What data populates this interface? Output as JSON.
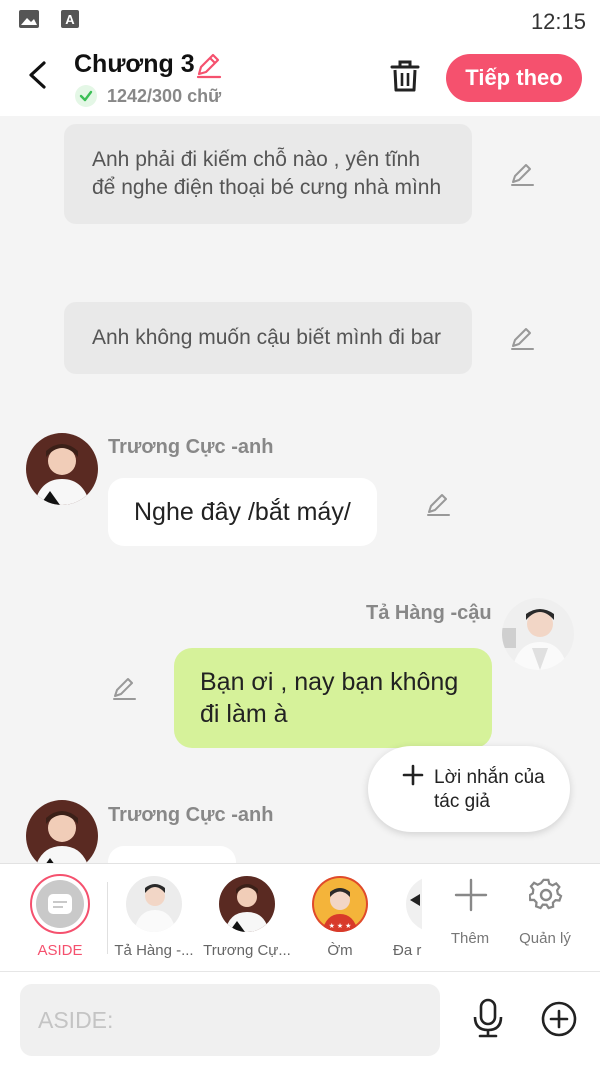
{
  "status_bar": {
    "time": "12:15"
  },
  "header": {
    "title": "Chương 3",
    "word_count": "1242/300 chữ",
    "next_label": "Tiếp theo"
  },
  "messages": {
    "narration_1": "Anh phải đi kiếm chỗ nào , yên tĩnh để nghe điện thoại bé cưng nhà mình",
    "narration_2": "Anh không muốn cậu biết mình đi bar",
    "msg_1": {
      "sender": "Trương Cực -anh",
      "text": "Nghe đây /bắt máy/"
    },
    "msg_2": {
      "sender": "Tả Hàng -cậu",
      "text": "Bạn ơi , nay bạn không đi làm à"
    },
    "msg_3": {
      "sender": "Trương Cực -anh"
    }
  },
  "author_note": {
    "label": "Lời nhắn của tác giả"
  },
  "character_bar": {
    "aside_label": "ASIDE",
    "characters": [
      {
        "label": "Tả Hàng -..."
      },
      {
        "label": "Trương Cự..."
      },
      {
        "label": "Ờm"
      },
      {
        "label": "Đa r"
      }
    ],
    "add_label": "Thêm",
    "manage_label": "Quản lý"
  },
  "input": {
    "placeholder": "ASIDE:"
  },
  "colors": {
    "accent": "#f5516e",
    "green_bubble": "#d6f29a"
  }
}
